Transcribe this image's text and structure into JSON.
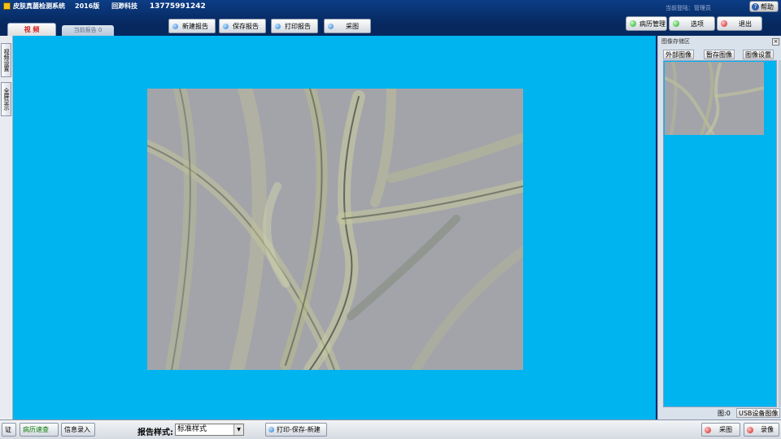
{
  "titlebar": {
    "app_name": "皮肤真菌检测系统",
    "version": "2016版",
    "company": "回渺科技",
    "phone": "13775991242",
    "user_label": "当前登陆：管理员",
    "help_label": "帮助"
  },
  "tabs": [
    {
      "label": "视 频"
    },
    {
      "label": "当前报告 0"
    }
  ],
  "toolbar": {
    "new_report": "新建报告",
    "save_report": "保存报告",
    "print_report": "打印报告",
    "capture": "采图"
  },
  "right_toolbar": {
    "records": "病历管理",
    "options": "选项",
    "exit": "退出"
  },
  "left_strip": {
    "video_settings": "视频设置",
    "fullscreen": "全屏显示"
  },
  "image_panel": {
    "title": "图像存储区",
    "external_image": "外部图像",
    "temp_image": "暂存图像",
    "image_settings": "图像设置",
    "count_label": "图:0",
    "usb_image": "USB设备图像"
  },
  "bottombar": {
    "cert": "证",
    "quick_check": "病历速查",
    "info_entry": "信息录入",
    "report_style_label": "报告样式:",
    "report_style_value": "标准样式",
    "print_save_new": "打印-保存-新建",
    "capture": "采图",
    "record": "录像"
  },
  "colors": {
    "view_background": "#00b4f0",
    "titlebar": "#0c3d86",
    "accent_red": "#d42020"
  },
  "icons": {
    "help": "help-icon",
    "capture": "blue-dot-icon",
    "records": "green-dot-icon",
    "exit": "red-dot-icon"
  }
}
